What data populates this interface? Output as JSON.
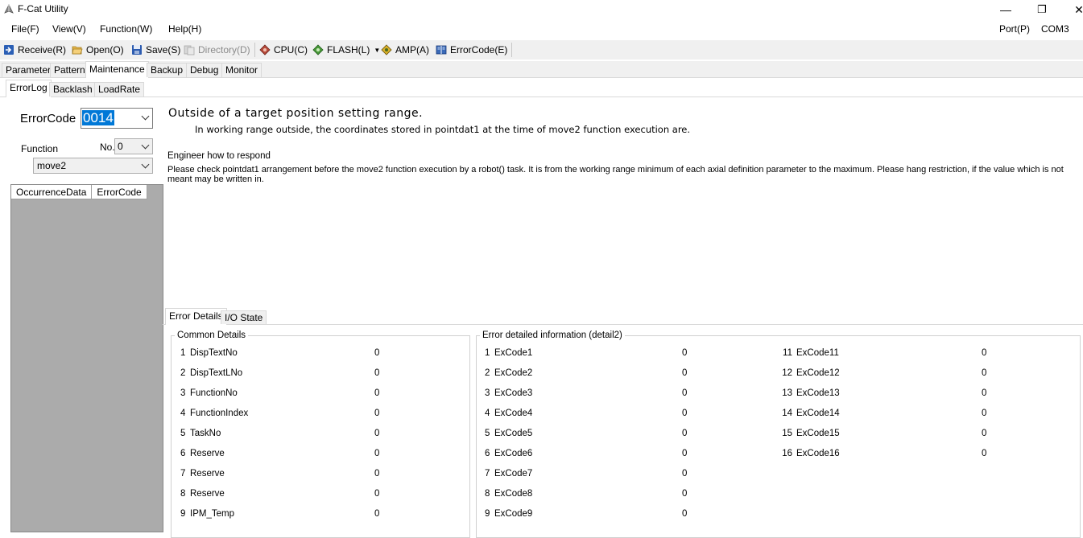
{
  "window": {
    "title": "F-Cat Utility",
    "minimize": "—",
    "restore": "❐",
    "close": "✕"
  },
  "menu": {
    "file": "File(F)",
    "view": "View(V)",
    "function": "Function(W)",
    "help": "Help(H)",
    "port": "Port(P)",
    "com": "COM3"
  },
  "toolbar": {
    "receive": "Receive(R)",
    "open": "Open(O)",
    "save": "Save(S)",
    "directory": "Directory(D)",
    "cpu": "CPU(C)",
    "flash": "FLASH(L)",
    "amp": "AMP(A)",
    "errorcode": "ErrorCode(E)"
  },
  "main_tabs": [
    "Parameter",
    "Pattern",
    "Maintenance",
    "Backup",
    "Debug",
    "Monitor"
  ],
  "sub_tabs": [
    "ErrorLog",
    "Backlash",
    "LoadRate"
  ],
  "error_panel": {
    "errorcode_label": "ErrorCode",
    "errorcode_value": "0014",
    "function_label": "Function",
    "no_label": "No.",
    "no_value": "0",
    "function_value": "move2"
  },
  "grid": {
    "columns": [
      "OccurrenceData",
      "ErrorCode"
    ]
  },
  "message": {
    "title": "Outside of a target position setting range.",
    "description": "In working range outside, the coordinates stored in pointdat1 at the time of move2 function execution are.",
    "engineer_label": "Engineer how to respond",
    "engineer_text": "Please check pointdat1 arrangement before the move2 function execution by a robot() task. It is from the working range minimum of each axial definition parameter to the maximum. Please hang restriction, if the value which is not meant may be written in."
  },
  "detail_tabs": [
    "Error Details",
    "I/O State"
  ],
  "common_details": {
    "title": "Common Details",
    "rows": [
      {
        "num": "1",
        "name": "DispTextNo",
        "value": "0"
      },
      {
        "num": "2",
        "name": "DispTextLNo",
        "value": "0"
      },
      {
        "num": "3",
        "name": "FunctionNo",
        "value": "0"
      },
      {
        "num": "4",
        "name": "FunctionIndex",
        "value": "0"
      },
      {
        "num": "5",
        "name": "TaskNo",
        "value": "0"
      },
      {
        "num": "6",
        "name": "Reserve",
        "value": "0"
      },
      {
        "num": "7",
        "name": "Reserve",
        "value": "0"
      },
      {
        "num": "8",
        "name": "Reserve",
        "value": "0"
      },
      {
        "num": "9",
        "name": "IPM_Temp",
        "value": "0"
      }
    ]
  },
  "detail2": {
    "title": "Error detailed information (detail2)",
    "col1": [
      {
        "num": "1",
        "name": "ExCode1",
        "value": "0"
      },
      {
        "num": "2",
        "name": "ExCode2",
        "value": "0"
      },
      {
        "num": "3",
        "name": "ExCode3",
        "value": "0"
      },
      {
        "num": "4",
        "name": "ExCode4",
        "value": "0"
      },
      {
        "num": "5",
        "name": "ExCode5",
        "value": "0"
      },
      {
        "num": "6",
        "name": "ExCode6",
        "value": "0"
      },
      {
        "num": "7",
        "name": "ExCode7",
        "value": "0"
      },
      {
        "num": "8",
        "name": "ExCode8",
        "value": "0"
      },
      {
        "num": "9",
        "name": "ExCode9",
        "value": "0"
      }
    ],
    "col2": [
      {
        "num": "11",
        "name": "ExCode11",
        "value": "0"
      },
      {
        "num": "12",
        "name": "ExCode12",
        "value": "0"
      },
      {
        "num": "13",
        "name": "ExCode13",
        "value": "0"
      },
      {
        "num": "14",
        "name": "ExCode14",
        "value": "0"
      },
      {
        "num": "15",
        "name": "ExCode15",
        "value": "0"
      },
      {
        "num": "16",
        "name": "ExCode16",
        "value": "0"
      }
    ]
  }
}
